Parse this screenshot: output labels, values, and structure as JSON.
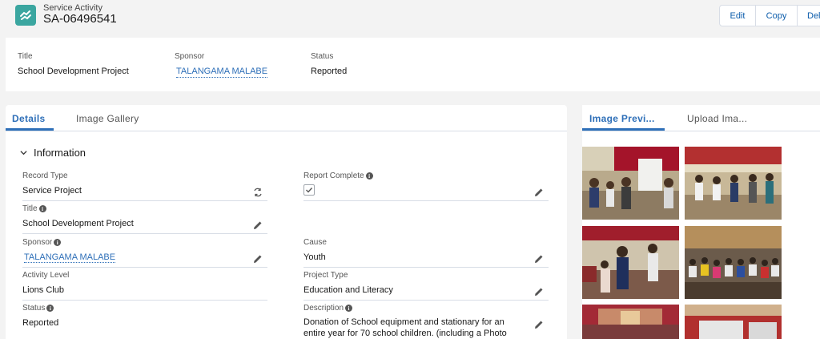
{
  "header": {
    "object_type": "Service Activity",
    "record_name": "SA-06496541",
    "actions": [
      "Edit",
      "Copy",
      "Del"
    ]
  },
  "highlights": {
    "title_label": "Title",
    "title_value": "School Development Project",
    "sponsor_label": "Sponsor",
    "sponsor_value": "TALANGAMA MALABE",
    "status_label": "Status",
    "status_value": "Reported"
  },
  "tabs": {
    "details": "Details",
    "gallery": "Image Gallery"
  },
  "section": {
    "title": "Information"
  },
  "fields": {
    "record_type_label": "Record Type",
    "record_type_value": "Service Project",
    "report_complete_label": "Report Complete",
    "report_complete_checked": true,
    "title_label": "Title",
    "title_value": "School Development Project",
    "sponsor_label": "Sponsor",
    "sponsor_value": "TALANGAMA MALABE",
    "cause_label": "Cause",
    "cause_value": "Youth",
    "activity_level_label": "Activity Level",
    "activity_level_value": "Lions Club",
    "project_type_label": "Project Type",
    "project_type_value": "Education and Literacy",
    "status_label": "Status",
    "status_value": "Reported",
    "description_label": "Description",
    "description_value": "Donation of School equipment and stationary for an entire year for 70 school children. (including a Photo copy"
  },
  "right_panel": {
    "tab_preview": "Image Previ...",
    "tab_upload": "Upload Ima..."
  },
  "colors": {
    "accent": "#2e6fb8",
    "app_icon": "#3ba6a0"
  }
}
